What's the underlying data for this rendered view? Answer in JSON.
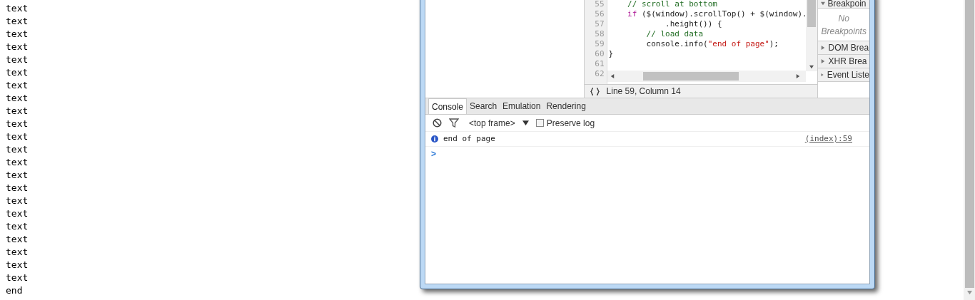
{
  "page_lines": [
    "text",
    "text",
    "text",
    "text",
    "text",
    "text",
    "text",
    "text",
    "text",
    "text",
    "text",
    "text",
    "text",
    "text",
    "text",
    "text",
    "text",
    "text",
    "text",
    "text",
    "text",
    "text",
    "end"
  ],
  "code": {
    "lines": [
      {
        "number": "55",
        "tokens": [
          {
            "kind": "comment",
            "text": "    // scroll at bottom"
          }
        ]
      },
      {
        "number": "56",
        "tokens": [
          {
            "kind": "keyword",
            "text": "    if"
          },
          {
            "kind": "plain",
            "text": " ($(window).scrollTop() + $(window)."
          }
        ]
      },
      {
        "number": "57",
        "tokens": [
          {
            "kind": "plain",
            "text": "            .height()) {"
          }
        ]
      },
      {
        "number": "58",
        "tokens": [
          {
            "kind": "comment",
            "text": "        // load data"
          }
        ]
      },
      {
        "number": "59",
        "tokens": [
          {
            "kind": "plain",
            "text": "        console.info("
          },
          {
            "kind": "string",
            "text": "\"end of page\""
          },
          {
            "kind": "plain",
            "text": ");"
          }
        ]
      },
      {
        "number": "60",
        "tokens": [
          {
            "kind": "plain",
            "text": "}"
          }
        ]
      },
      {
        "number": "61"
      },
      {
        "number": "62"
      }
    ],
    "status": "Line 59, Column 14"
  },
  "sidebar": {
    "header": "Breakpoin",
    "empty_text": "No Breakpoints",
    "sections": [
      {
        "label": "DOM Brea",
        "expanded": false
      },
      {
        "label": "XHR Brea",
        "expanded": false
      },
      {
        "label": "Event Liste",
        "expanded": false
      }
    ]
  },
  "drawer": {
    "tabs": [
      {
        "label": "Console",
        "selected": true
      },
      {
        "label": "Search",
        "selected": false
      },
      {
        "label": "Emulation",
        "selected": false
      },
      {
        "label": "Rendering",
        "selected": false
      }
    ],
    "frame_select": "<top frame>",
    "preserve_log": {
      "label": "Preserve log",
      "checked": false
    },
    "messages": [
      {
        "kind": "info",
        "text": "end of page",
        "source": "(index):59"
      }
    ],
    "prompt": ">"
  }
}
